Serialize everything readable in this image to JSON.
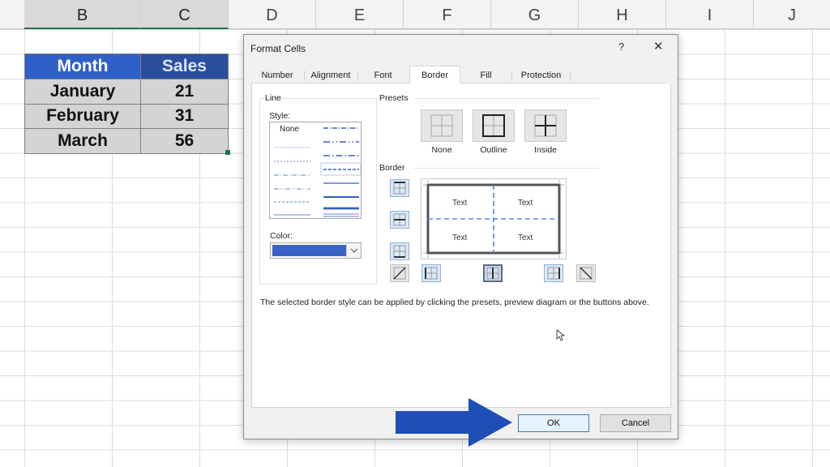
{
  "columns": [
    "B",
    "C",
    "D",
    "E",
    "F",
    "G",
    "H",
    "I",
    "J"
  ],
  "table": {
    "headers": [
      "Month",
      "Sales"
    ],
    "rows": [
      {
        "month": "January",
        "sales": "21"
      },
      {
        "month": "February",
        "sales": "31"
      },
      {
        "month": "March",
        "sales": "56"
      }
    ]
  },
  "dialog": {
    "title": "Format Cells",
    "help": "?",
    "close": "✕",
    "tabs": [
      "Number",
      "Alignment",
      "Font",
      "Border",
      "Fill",
      "Protection"
    ],
    "active_tab": "Border",
    "line": {
      "group_label": "Line",
      "style_label": "Style:",
      "none_label": "None",
      "color_label": "Color:",
      "selected_color": "#3a63c7"
    },
    "presets": {
      "label": "Presets",
      "items": [
        "None",
        "Outline",
        "Inside"
      ]
    },
    "border": {
      "label": "Border",
      "preview_text": [
        "Text",
        "Text",
        "Text",
        "Text"
      ],
      "accent_color": "#5b87d6"
    },
    "hint": "The selected border style can be applied by clicking the presets, preview diagram or the buttons above.",
    "ok_label": "OK",
    "cancel_label": "Cancel"
  },
  "colors": {
    "header_blue": "#2f5fc9",
    "arrow_blue": "#1e4fb5",
    "cell_gray": "#d4d4d4"
  }
}
